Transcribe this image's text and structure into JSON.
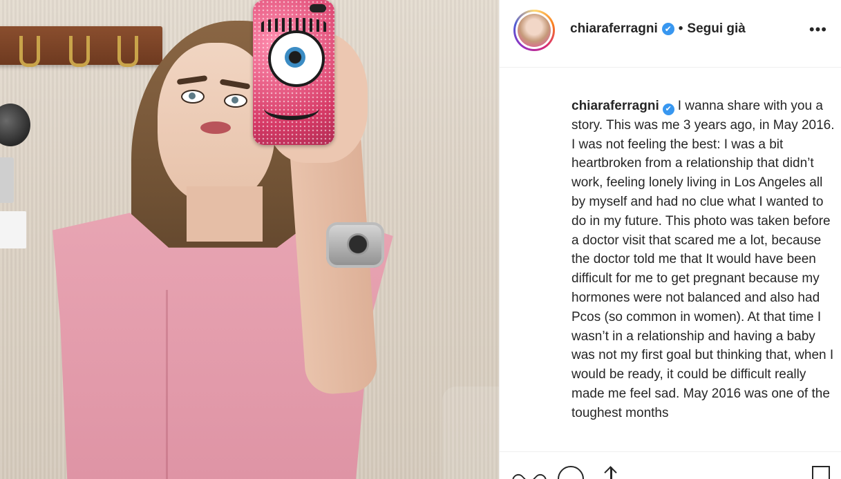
{
  "post": {
    "username": "chiaraferragni",
    "verified_mark": "✔",
    "separator": "•",
    "follow_status": "Segui già",
    "more_options": "•••",
    "caption": {
      "username": "chiaraferragni",
      "text": "I wanna share with you a story. This was me 3 years ago, in May 2016. I was not feeling the best: I was a bit heartbroken from a relationship that didn’t work, feeling lonely living in Los Angeles all by myself and had no clue what I wanted to do in my future. This photo was taken before a doctor visit that scared me a lot, because the doctor told me that It would have been difficult for me to get pregnant because my hormones were not balanced and also had Pcos (so common in women). At that time I wasn’t in a relationship and having a baby was not my first goal but thinking that, when I would be ready, it could be difficult really made me feel sad. May 2016 was one of the toughest months"
    },
    "icons": {
      "avatar": "profile-avatar",
      "verified": "verified-badge-icon",
      "like": "heart-icon",
      "comment": "comment-icon",
      "share": "share-icon",
      "save": "bookmark-icon"
    },
    "colors": {
      "verified_blue": "#3897f0",
      "text": "#262626",
      "divider": "#efefef"
    }
  }
}
